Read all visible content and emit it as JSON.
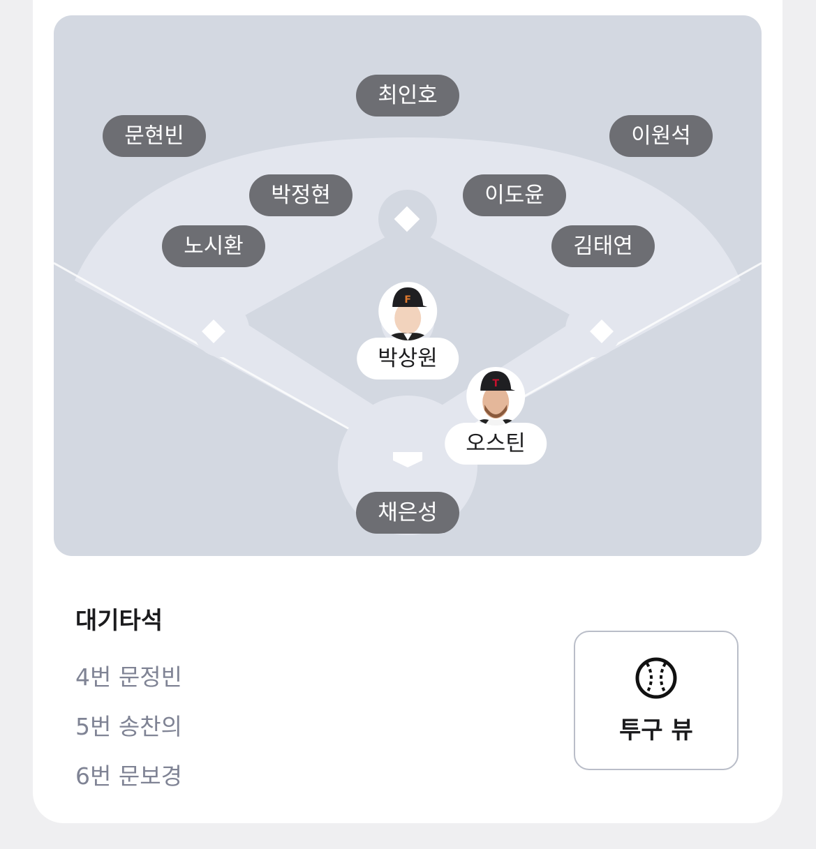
{
  "field": {
    "fielders": [
      {
        "id": "cf",
        "name": "최인호"
      },
      {
        "id": "lf",
        "name": "문현빈"
      },
      {
        "id": "rf",
        "name": "이원석"
      },
      {
        "id": "ss",
        "name": "박정현"
      },
      {
        "id": "2b",
        "name": "이도윤"
      },
      {
        "id": "3b",
        "name": "노시환"
      },
      {
        "id": "1b",
        "name": "김태연"
      },
      {
        "id": "c",
        "name": "채은성"
      }
    ],
    "pitcher": {
      "name": "박상원",
      "cap_color": "#e07a2f"
    },
    "batter": {
      "name": "오스틴",
      "cap_color": "#c8102e"
    }
  },
  "on_deck": {
    "title": "대기타석",
    "items": [
      "4번 문정빈",
      "5번 송찬의",
      "6번 문보경"
    ]
  },
  "pitch_view_button": {
    "label": "투구 뷰",
    "icon": "baseball-icon"
  }
}
